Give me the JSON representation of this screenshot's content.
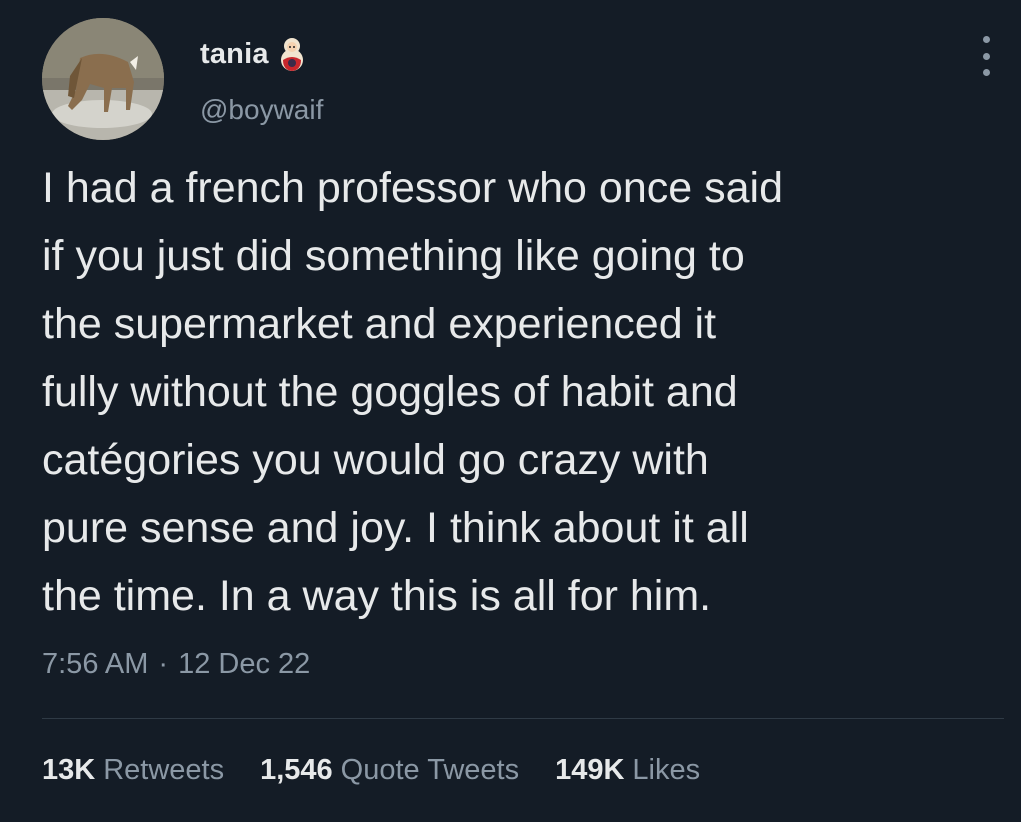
{
  "tweet": {
    "author": {
      "display_name": "tania",
      "handle": "@boywaif",
      "avatar_icon": "deer-photo-avatar",
      "name_badge_icon": "matryoshka-doll-emoji"
    },
    "more_icon": "more-vertical-icon",
    "text_lines": [
      "I had a french professor who once said",
      "if you just did something like going to",
      "the supermarket and experienced it",
      "fully without the goggles of habit and",
      "catégories you would go crazy with",
      "pure sense and joy. I think about it all",
      "the time. In a way this is all for him."
    ],
    "time": "7:56 AM",
    "separator": "·",
    "date": "12 Dec 22",
    "stats": {
      "retweets_count": "13K",
      "retweets_label": "Retweets",
      "quotes_count": "1,546",
      "quotes_label": "Quote Tweets",
      "likes_count": "149K",
      "likes_label": "Likes"
    }
  },
  "colors": {
    "background": "#141c26",
    "primary_text": "#e7e9ea",
    "secondary_text": "#8b98a5",
    "divider": "#2f3a45"
  }
}
